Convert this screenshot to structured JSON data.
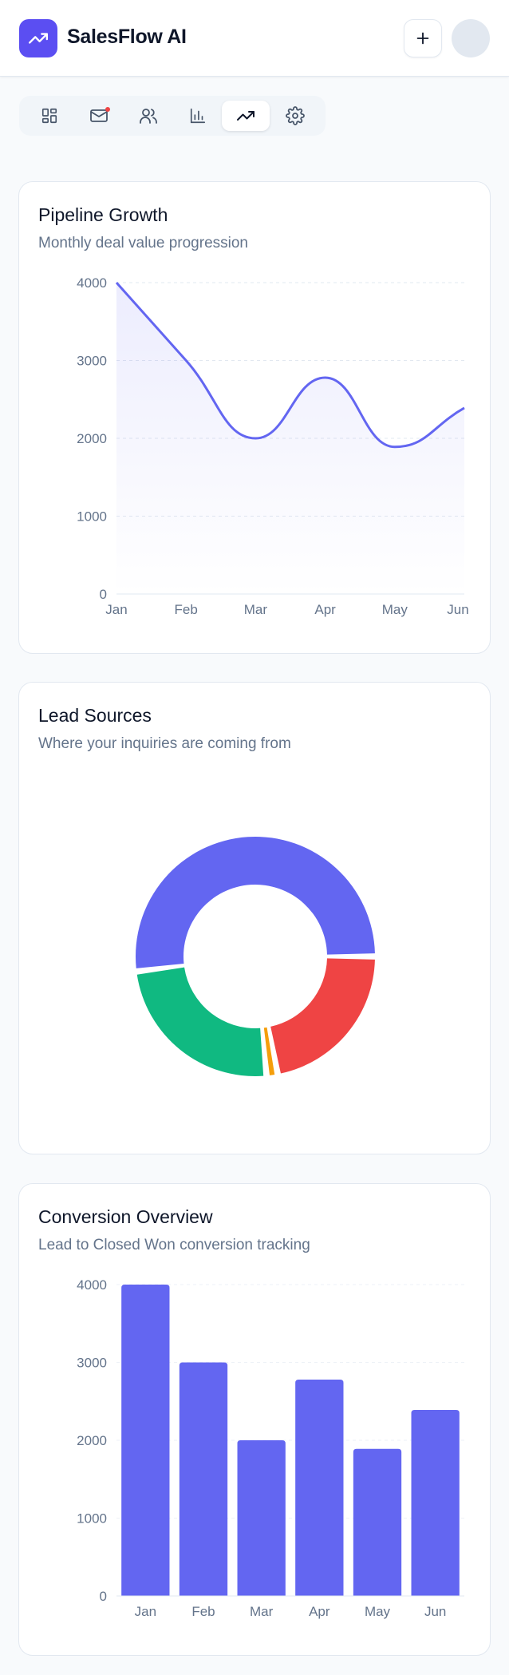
{
  "header": {
    "app_title": "SalesFlow AI",
    "logo_icon": "trending-up-icon",
    "add_icon": "plus-icon"
  },
  "tabs": [
    {
      "icon": "dashboard-icon",
      "active": false,
      "notification": false
    },
    {
      "icon": "mail-icon",
      "active": false,
      "notification": true
    },
    {
      "icon": "users-icon",
      "active": false,
      "notification": false
    },
    {
      "icon": "bar-chart-icon",
      "active": false,
      "notification": false
    },
    {
      "icon": "trending-up-icon",
      "active": true,
      "notification": false
    },
    {
      "icon": "settings-icon",
      "active": false,
      "notification": false
    }
  ],
  "colors": {
    "accent": "#6366f1",
    "red": "#ef4444",
    "green": "#10b981",
    "orange": "#f59e0b",
    "notification": "#ef4444"
  },
  "cards": {
    "pipeline": {
      "title": "Pipeline Growth",
      "subtitle": "Monthly deal value progression"
    },
    "leads": {
      "title": "Lead Sources",
      "subtitle": "Where your inquiries are coming from"
    },
    "conversion": {
      "title": "Conversion Overview",
      "subtitle": "Lead to Closed Won conversion tracking"
    }
  },
  "chart_data": [
    {
      "type": "area",
      "title": "Pipeline Growth",
      "categories": [
        "Jan",
        "Feb",
        "Mar",
        "Apr",
        "May",
        "Jun"
      ],
      "values": [
        4000,
        3000,
        2000,
        2780,
        1890,
        2390
      ],
      "ylim": [
        0,
        4000
      ],
      "yticks": [
        0,
        1000,
        2000,
        3000,
        4000
      ],
      "grid": true,
      "color": "#6366f1"
    },
    {
      "type": "pie",
      "title": "Lead Sources",
      "donut": true,
      "slices": [
        {
          "value": 52,
          "color": "#6366f1"
        },
        {
          "value": 22,
          "color": "#ef4444"
        },
        {
          "value": 1.5,
          "color": "#f59e0b"
        },
        {
          "value": 24.5,
          "color": "#10b981"
        }
      ]
    },
    {
      "type": "bar",
      "title": "Conversion Overview",
      "categories": [
        "Jan",
        "Feb",
        "Mar",
        "Apr",
        "May",
        "Jun"
      ],
      "values": [
        4000,
        3000,
        2000,
        2780,
        1890,
        2390
      ],
      "ylim": [
        0,
        4000
      ],
      "yticks": [
        0,
        1000,
        2000,
        3000,
        4000
      ],
      "grid": true,
      "color": "#6366f1"
    }
  ]
}
